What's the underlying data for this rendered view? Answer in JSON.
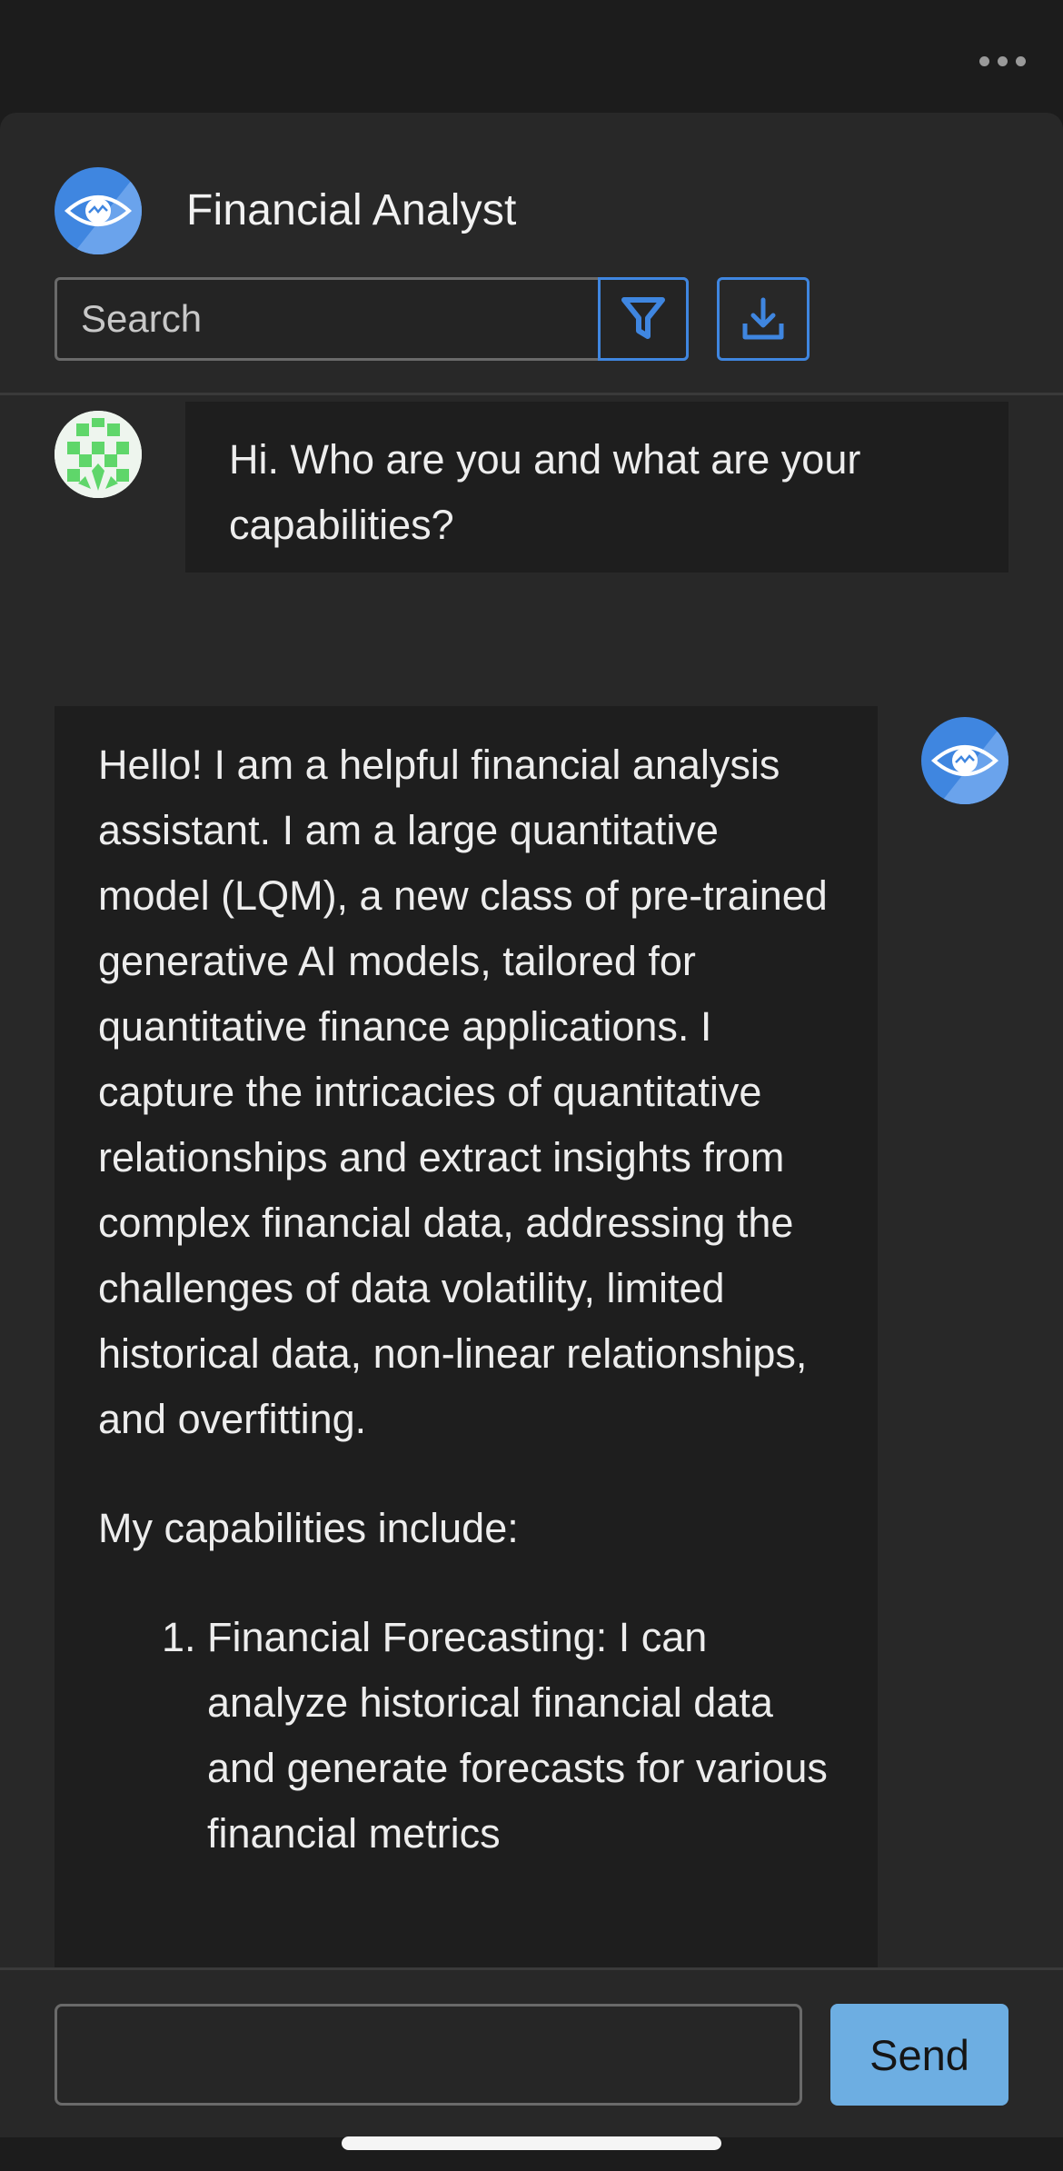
{
  "agent": {
    "name": "Financial Analyst"
  },
  "search": {
    "placeholder": "Search"
  },
  "icons": {
    "more": "more-horizontal-icon",
    "agent_avatar": "eye-icon",
    "filter": "filter-icon",
    "download": "download-icon",
    "user_avatar": "identicon"
  },
  "colors": {
    "accent": "#3f86e0",
    "send_button": "#6daee2",
    "panel": "#282828",
    "bubble": "#1e1e1e"
  },
  "messages": [
    {
      "role": "user",
      "text": "Hi. Who are you and what are your capabilities?"
    },
    {
      "role": "assistant",
      "paragraphs": [
        "Hello! I am a helpful financial analysis assistant. I am a large quantitative model (LQM), a new class of pre-trained generative AI models, tailored for quantitative finance applications. I capture the intricacies of quantitative relationships and extract insights from complex financial data, addressing the challenges of data volatility, limited historical data, non-linear relationships, and overfitting.",
        "My capabilities include:"
      ],
      "list": [
        "Financial Forecasting: I can analyze historical financial data and generate forecasts for various financial metrics"
      ]
    }
  ],
  "composer": {
    "value": "",
    "send_label": "Send"
  }
}
